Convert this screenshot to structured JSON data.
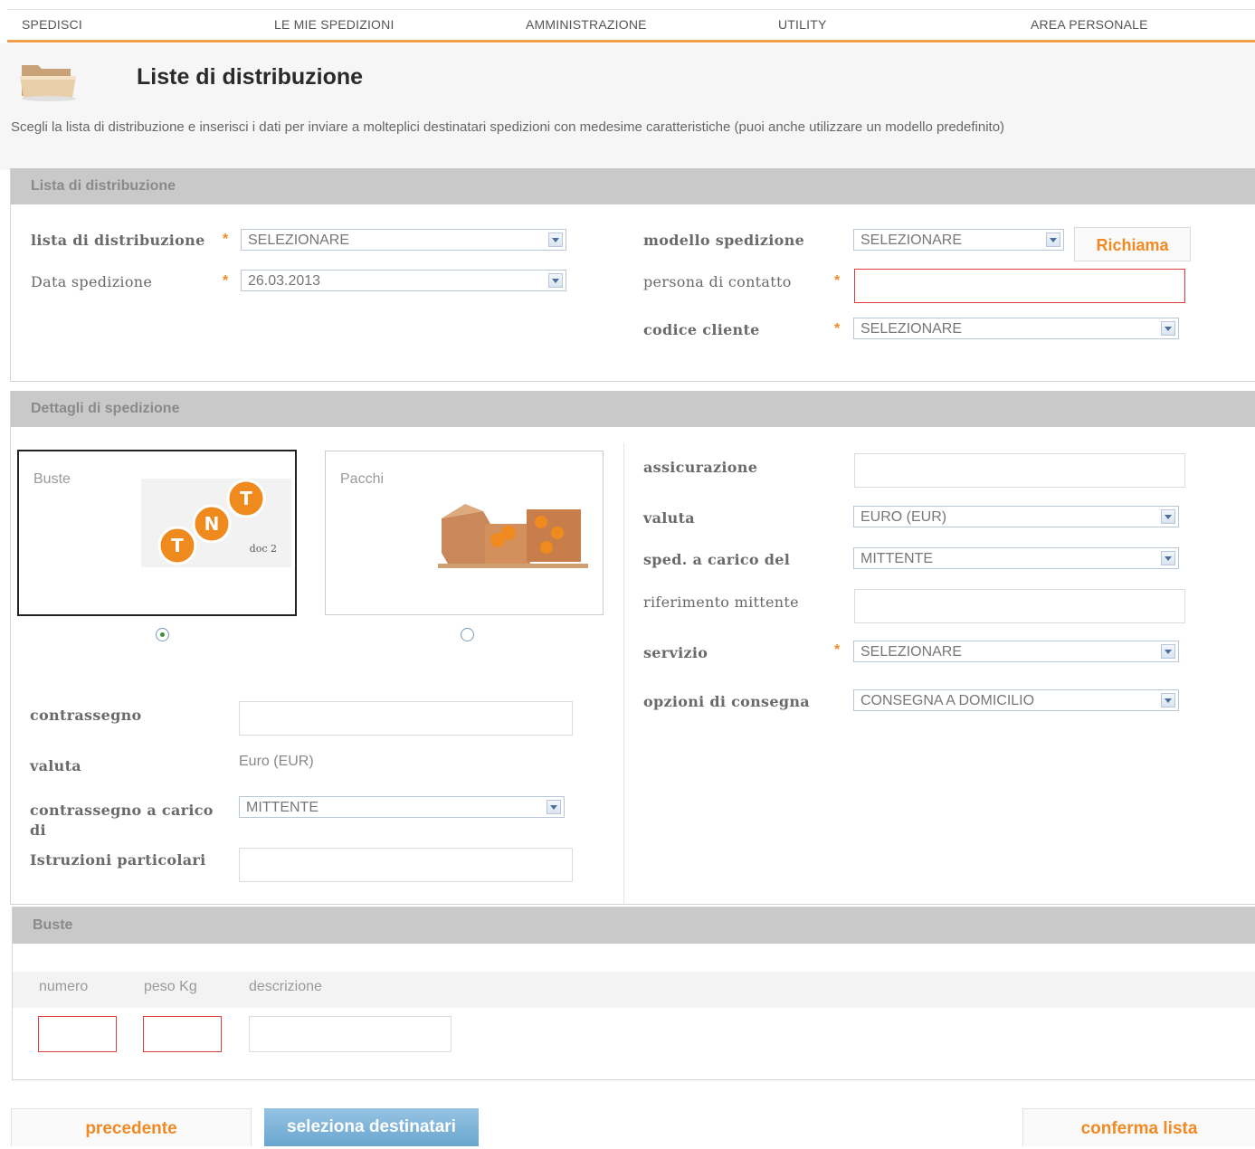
{
  "nav": {
    "spedisci": "SPEDISCI",
    "mie_spedizioni": "LE MIE SPEDIZIONI",
    "amministrazione": "AMMINISTRAZIONE",
    "utility": "UTILITY",
    "area_personale": "AREA PERSONALE"
  },
  "page": {
    "title": "Liste di distribuzione",
    "intro": "Scegli la lista di distribuzione e inserisci i dati per inviare a molteplici destinatari spedizioni con medesime caratteristiche (puoi anche utilizzare un modello predefinito)"
  },
  "lista_section": {
    "header": "Lista di distribuzione",
    "lista_label": "lista di distribuzione",
    "lista_value": "SELEZIONARE",
    "data_label": "Data spedizione",
    "data_value": "26.03.2013",
    "modello_label": "modello spedizione",
    "modello_value": "SELEZIONARE",
    "richiama_label": "Richiama",
    "contatto_label": "persona di contatto",
    "contatto_value": "",
    "codice_label": "codice cliente",
    "codice_value": "SELEZIONARE",
    "required_mark": "*"
  },
  "dettagli_section": {
    "header": "Dettagli di spedizione",
    "card_buste": "Buste",
    "card_pacchi": "Pacchi",
    "selected": "Buste",
    "tnt_logo_sub": "doc 2",
    "contrassegno_label": "contrassegno",
    "valuta_label": "valuta",
    "valuta_value": "Euro (EUR)",
    "contrassegno_carico_label": "contrassegno a carico di",
    "contrassegno_carico_value": "MITTENTE",
    "istruzioni_label": "Istruzioni particolari",
    "assicurazione_label": "assicurazione",
    "valuta2_label": "valuta",
    "valuta2_value": "EURO (EUR)",
    "sped_carico_label": "sped. a carico del",
    "sped_carico_value": "MITTENTE",
    "riferimento_label": "riferimento mittente",
    "servizio_label": "servizio",
    "servizio_value": "SELEZIONARE",
    "opzioni_label": "opzioni di consegna",
    "opzioni_value": "CONSEGNA A DOMICILIO"
  },
  "buste_section": {
    "header": "Buste",
    "col_numero": "numero",
    "col_peso": "peso Kg",
    "col_descrizione": "descrizione"
  },
  "footer": {
    "precedente": "precedente",
    "seleziona": "seleziona destinatari",
    "conferma": "conferma lista"
  },
  "colors": {
    "accent": "#f08a24",
    "section_header": "#c9c9c9",
    "primary_button": "#7fb2d6",
    "error_border": "#e23b3b"
  }
}
